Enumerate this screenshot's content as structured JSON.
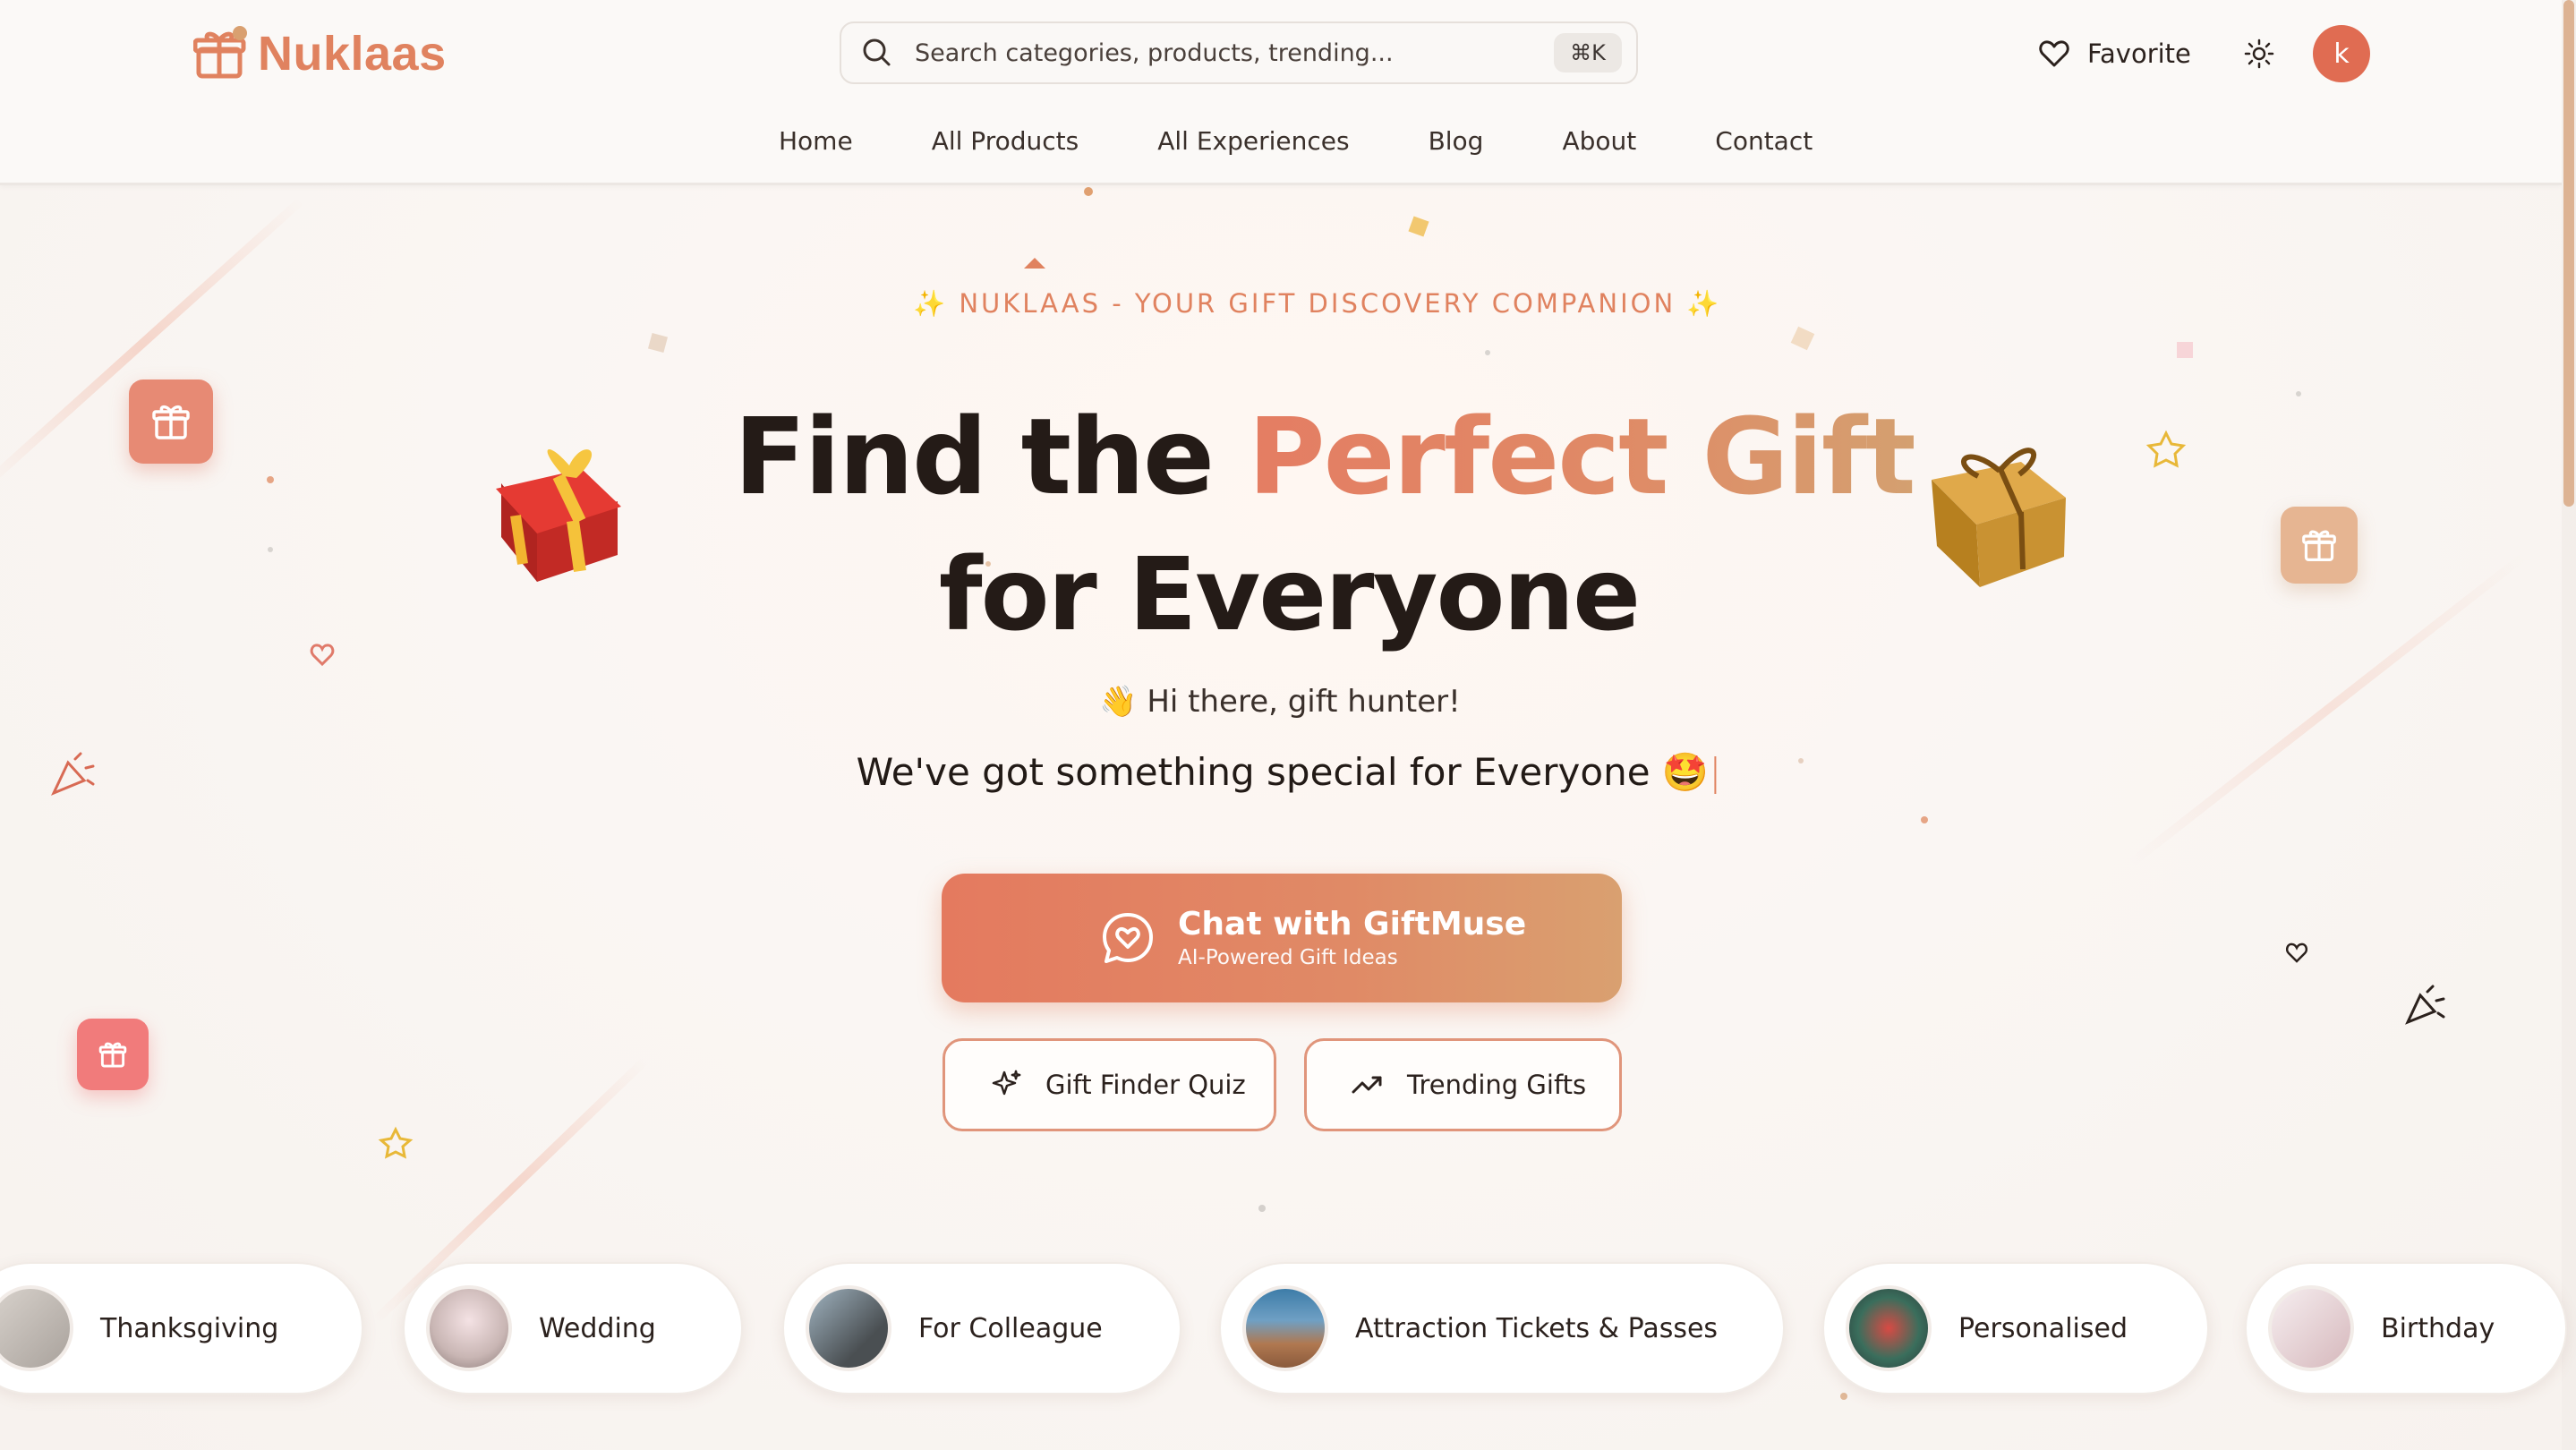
{
  "brand": {
    "name": "Nuklaas",
    "color": "#e0825f"
  },
  "search": {
    "placeholder": "Search categories, products, trending...",
    "shortcut": "⌘K"
  },
  "header": {
    "favorite_label": "Favorite",
    "avatar_initial": "k"
  },
  "nav": {
    "items": [
      "Home",
      "All Products",
      "All Experiences",
      "Blog",
      "About",
      "Contact"
    ]
  },
  "hero": {
    "tagline": "NUKLAAS - YOUR GIFT DISCOVERY COMPANION",
    "title_plain": "Find the",
    "title_accent": "Perfect Gift",
    "title_line2": "for Everyone",
    "greeting": "👋 Hi there, gift hunter!",
    "subtitle": "We've got something special for Everyone 🤩",
    "caret": "|"
  },
  "cta": {
    "chat_title": "Chat with GiftMuse",
    "chat_subtitle": "AI-Powered Gift Ideas",
    "quiz_label": "Gift Finder Quiz",
    "trending_label": "Trending Gifts"
  },
  "categories": [
    "Thanksgiving",
    "Wedding",
    "For Colleague",
    "Attraction Tickets & Passes",
    "Personalised",
    "Birthday"
  ],
  "colors": {
    "accent": "#e0825f",
    "accent_gold": "#d4a070",
    "avatar": "#e06c52"
  }
}
